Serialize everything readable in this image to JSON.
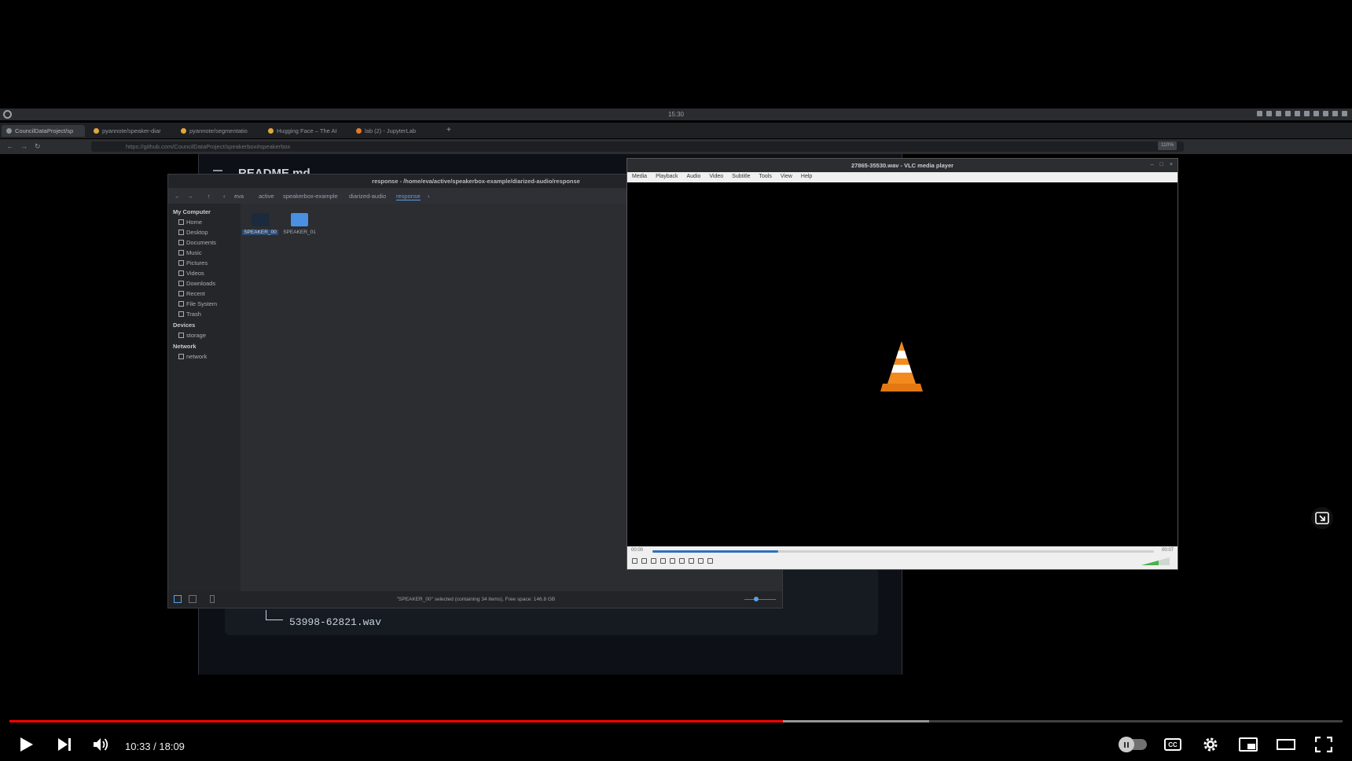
{
  "desktop": {
    "clock": "15:30"
  },
  "browser": {
    "tabs": [
      {
        "label": "CouncilDataProject/sp"
      },
      {
        "label": "pyannote/speaker-diar"
      },
      {
        "label": "pyannote/segmentatio"
      },
      {
        "label": "Hugging Face – The AI"
      },
      {
        "label": "lab (2) - JupyterLab"
      }
    ],
    "url": "https://github.com/CouncilDataProject/speakerbox#speakerbox",
    "zoom": "110%"
  },
  "github": {
    "heading": "README.md",
    "code_line": "53998-62821.wav"
  },
  "file_manager": {
    "title": "response - /home/eva/active/speakerbox-example/diarized-audio/response",
    "breadcrumbs": [
      "eva",
      "active",
      "speakerbox-example",
      "diarized-audio",
      "response"
    ],
    "sidebar": {
      "my_computer": "My Computer",
      "items": [
        "Home",
        "Desktop",
        "Documents",
        "Music",
        "Pictures",
        "Videos",
        "Downloads",
        "Recent",
        "File System",
        "Trash"
      ],
      "devices": "Devices",
      "device_items": [
        "storage"
      ],
      "network": "Network",
      "network_items": [
        "network"
      ]
    },
    "folders": [
      {
        "name": "SPEAKER_00"
      },
      {
        "name": "SPEAKER_01"
      }
    ],
    "status": "\"SPEAKER_00\" selected (containing 34 items), Free space: 146.8 GB"
  },
  "vlc": {
    "title": "27865-35530.wav - VLC media player",
    "menu": [
      "Media",
      "Playback",
      "Audio",
      "Video",
      "Subtitle",
      "Tools",
      "View",
      "Help"
    ],
    "time_elapsed": "00:00",
    "time_total": "00:07",
    "seek_fraction": 0.25
  },
  "youtube": {
    "time": "10:33 / 18:09",
    "played_fraction": 0.58,
    "buffered_fraction": 0.69,
    "accent": "#ff0000"
  }
}
